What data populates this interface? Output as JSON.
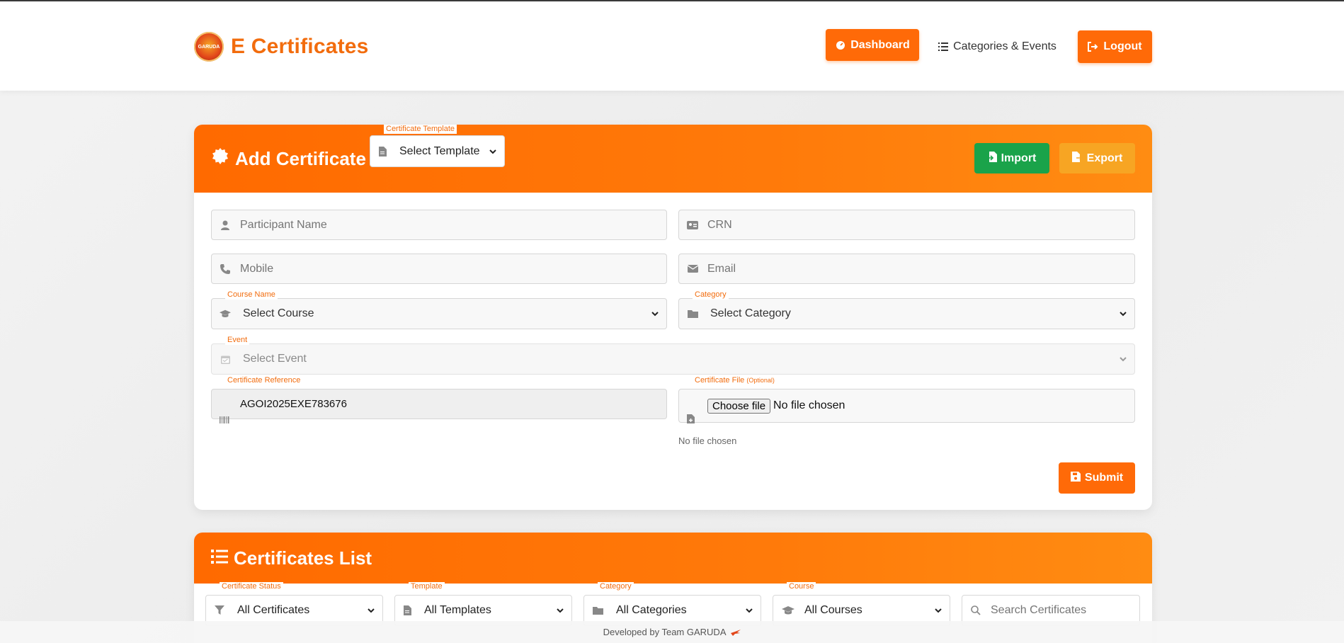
{
  "header": {
    "brand": "E Certificates",
    "logo_text": "GARUDA",
    "nav": {
      "dashboard": "Dashboard",
      "categories_events": "Categories & Events",
      "logout": "Logout"
    }
  },
  "add_certificate": {
    "title": "Add Certificate",
    "template_label": "Certificate Template",
    "template_value": "Select Template",
    "import_label": "Import",
    "export_label": "Export",
    "participant_placeholder": "Participant Name",
    "crn_placeholder": "CRN",
    "mobile_placeholder": "Mobile",
    "email_placeholder": "Email",
    "course_label": "Course Name",
    "course_value": "Select Course",
    "category_label": "Category",
    "category_value": "Select Category",
    "event_label": "Event",
    "event_value": "Select Event",
    "reference_label": "Certificate Reference",
    "reference_value": "AGOI2025EXE783676",
    "file_label": "Certificate File",
    "file_optional": "(Optional)",
    "choose_file": "Choose file",
    "no_file": "No file chosen",
    "file_status": "No file chosen",
    "submit_label": "Submit"
  },
  "certificates_list": {
    "title": "Certificates List",
    "filters": {
      "status_label": "Certificate Status",
      "status_value": "All Certificates",
      "template_label": "Template",
      "template_value": "All Templates",
      "category_label": "Category",
      "category_value": "All Categories",
      "course_label": "Course",
      "course_value": "All Courses",
      "search_placeholder": "Search Certificates"
    }
  },
  "footer": {
    "text": "Developed by Team GARUDA"
  },
  "colors": {
    "accent": "#ff6a08",
    "import_green": "#1aa34a",
    "export_amber": "#f5a623"
  }
}
